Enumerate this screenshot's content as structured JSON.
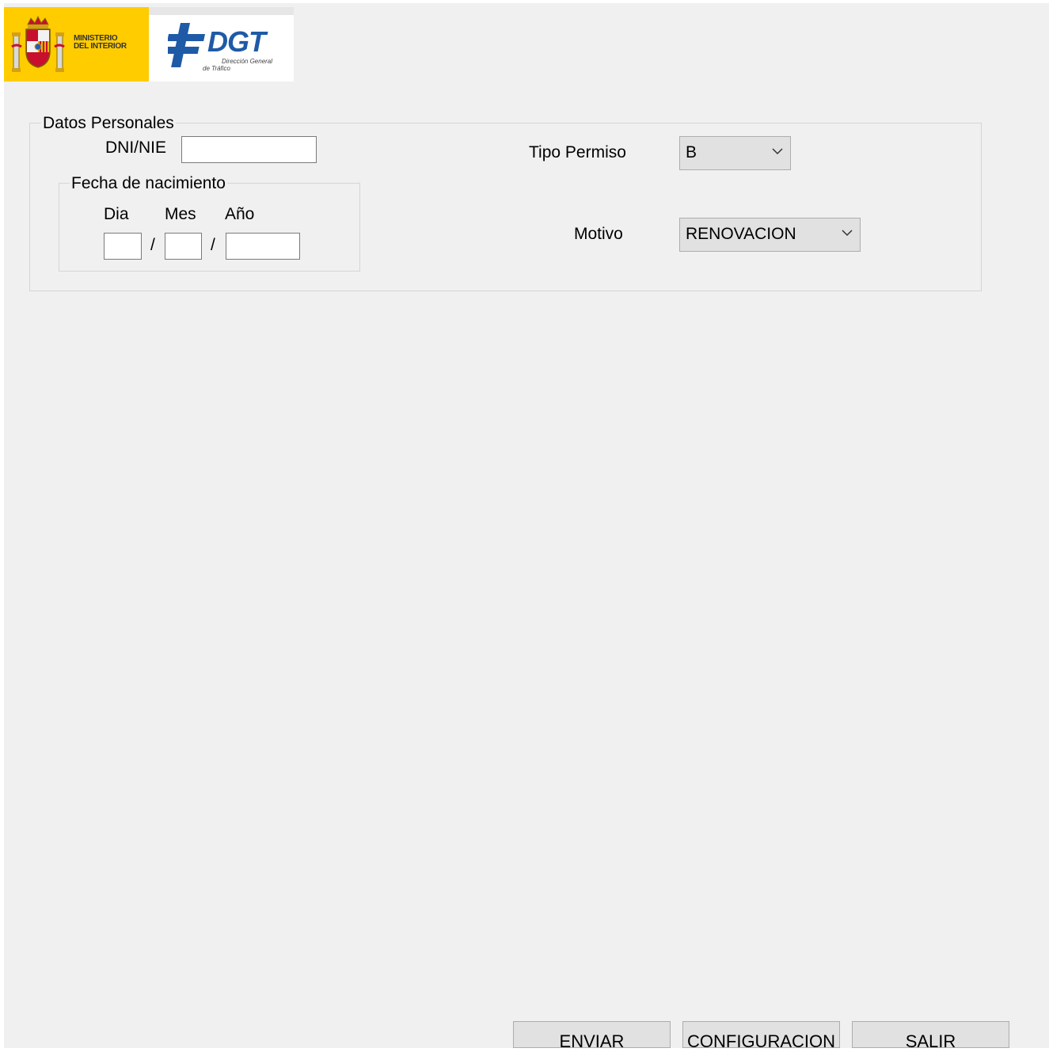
{
  "header": {
    "ministry_logo": {
      "line1": "MINISTERIO",
      "line2": "DEL INTERIOR",
      "brand_color": "#ffcc00"
    },
    "dgt_logo": {
      "name": "DGT",
      "subtitle_line1": "Dirección General",
      "subtitle_line2": "de Tráfico",
      "brand_color": "#1f5aa6"
    }
  },
  "datos_personales": {
    "title": "Datos Personales",
    "dni_label": "DNI/NIE",
    "dni_value": "",
    "fecha_nacimiento": {
      "title": "Fecha de nacimiento",
      "dia_label": "Dia",
      "mes_label": "Mes",
      "anio_label": "Año",
      "separator": "/",
      "dia_value": "",
      "mes_value": "",
      "anio_value": ""
    },
    "tipo_permiso": {
      "label": "Tipo Permiso",
      "selected": "B"
    },
    "motivo": {
      "label": "Motivo",
      "selected": "RENOVACION"
    }
  },
  "buttons": {
    "enviar": "ENVIAR",
    "configuracion": "CONFIGURACION",
    "salir": "SALIR"
  },
  "icons": {
    "combo_arrow": "chevron-down-icon",
    "crest": "coat-of-arms-icon",
    "dgt_mark": "dgt-mark-icon"
  }
}
